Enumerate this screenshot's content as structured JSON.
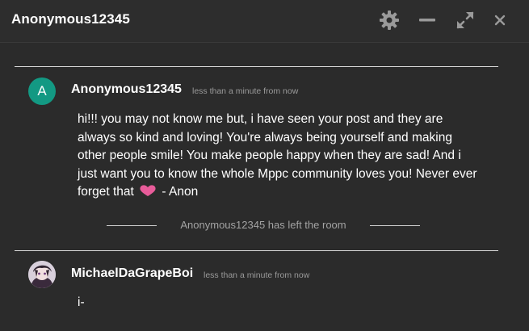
{
  "window": {
    "title": "Anonymous12345",
    "icons": [
      "gear-icon",
      "minimize-icon",
      "maximize-icon",
      "close-icon"
    ]
  },
  "messages": [
    {
      "avatar_letter": "A",
      "avatar_color": "#139983",
      "username": "Anonymous12345",
      "timestamp": "less than a minute from now",
      "text_before_heart": "hi!!! you may not know me but, i have seen your post and they are always so kind and loving! You're always being yourself and making other people smile! You make people happy when they are sad! And i just want you to know the whole Mppc community loves you! Never ever forget that",
      "emoji": "heart-icon",
      "text_after_heart": "- Anon"
    },
    {
      "avatar_icon": "user-avatar-image",
      "username": "MichaelDaGrapeBoi",
      "timestamp": "less than a minute from now",
      "text": "i-"
    }
  ],
  "system": {
    "left_room_text": "Anonymous12345 has left the room"
  },
  "colors": {
    "background": "#2b2b2b",
    "text": "#ffffff",
    "muted": "#9a9a9a",
    "heart": "#e85c9a"
  }
}
